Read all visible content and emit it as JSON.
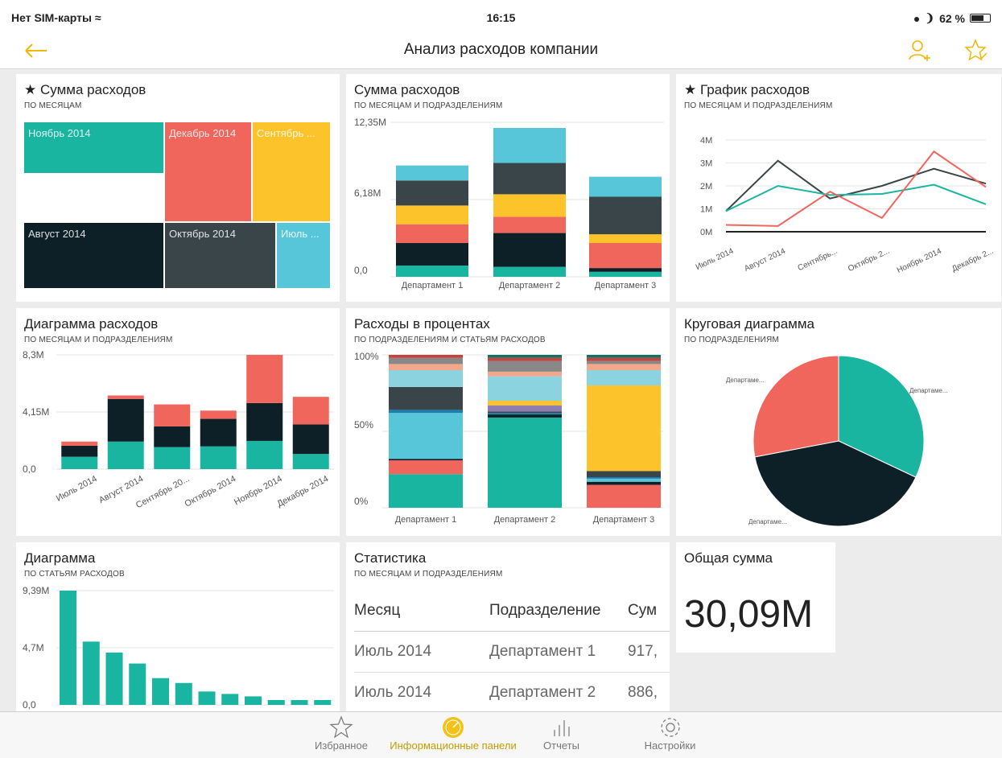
{
  "status_bar": {
    "carrier": "Нет SIM-карты",
    "time": "16:15",
    "battery": "62 %"
  },
  "nav": {
    "title": "Анализ расходов компании",
    "back_icon": "back-arrow-icon",
    "add_user_icon": "add-user-icon",
    "favorite_icon": "favorite-star-icon"
  },
  "tiles": {
    "treemap": {
      "title": "Сумма расходов",
      "subtitle": "ПО МЕСЯЦАМ",
      "starred": "★",
      "cells": [
        {
          "label": "Ноябрь 2014",
          "color": "#1ab5a0"
        },
        {
          "label": "Декабрь 2014",
          "color": "#f0665c"
        },
        {
          "label": "Сентябрь ...",
          "color": "#fcc42a"
        },
        {
          "label": "Август 2014",
          "color": "#0e2027"
        },
        {
          "label": "Октябрь 2014",
          "color": "#394548"
        },
        {
          "label": "Июль ...",
          "color": "#57c6d8"
        }
      ]
    },
    "stacked_bars": {
      "title": "Сумма расходов",
      "subtitle": "ПО МЕСЯЦАМ И ПОДРАЗДЕЛЕНИЯМ",
      "y_ticks": [
        "12,35M",
        "6,18M",
        "0,0"
      ]
    },
    "line_chart": {
      "title": "График расходов",
      "subtitle": "ПО МЕСЯЦАМ И ПОДРАЗДЕЛЕНИЯМ",
      "starred": "★",
      "y_ticks": [
        "4M",
        "3M",
        "2M",
        "1M",
        "0M"
      ]
    },
    "column_chart": {
      "title": "Диаграмма расходов",
      "subtitle": "ПО МЕСЯЦАМ И ПОДРАЗДЕЛЕНИЯМ",
      "y_ticks": [
        "8,3M",
        "4,15M",
        "0,0"
      ]
    },
    "percent_chart": {
      "title": "Расходы в процентах",
      "subtitle": "ПО ПОДРАЗДЕЛЕНИЯМ И СТАТЬЯМ РАСХОДОВ",
      "y_ticks": [
        "100%",
        "50%",
        "0%"
      ]
    },
    "pie_chart": {
      "title": "Круговая диаграмма",
      "subtitle": "ПО ПОДРАЗДЕЛЕНИЯМ"
    },
    "bar_chart": {
      "title": "Диаграмма",
      "subtitle": "ПО СТАТЬЯМ РАСХОДОВ",
      "y_ticks": [
        "9,39M",
        "4,7M",
        "0,0"
      ]
    },
    "stats": {
      "title": "Статистика",
      "subtitle": "ПО МЕСЯЦАМ И ПОДРАЗДЕЛЕНИЯМ",
      "headers": [
        "Месяц",
        "Подразделение",
        "Сум"
      ],
      "rows": [
        [
          "Июль 2014",
          "Департамент 1",
          "917,"
        ],
        [
          "Июль 2014",
          "Департамент 2",
          "886,"
        ]
      ]
    },
    "kpi": {
      "title": "Общая сумма",
      "value": "30,09M"
    }
  },
  "chart_data": [
    {
      "type": "bar",
      "stacked": true,
      "categories": [
        "Департамент 1",
        "Департамент 2",
        "Департамент 3"
      ],
      "ylim": [
        0,
        12.35
      ],
      "series": [
        {
          "color": "#1ab5a0",
          "values": [
            0.9,
            0.8,
            0.4
          ]
        },
        {
          "color": "#0e2027",
          "values": [
            1.8,
            2.7,
            0.3
          ]
        },
        {
          "color": "#f0665c",
          "values": [
            1.5,
            1.3,
            2.0
          ]
        },
        {
          "color": "#fcc42a",
          "values": [
            1.5,
            1.8,
            0.7
          ]
        },
        {
          "color": "#394548",
          "values": [
            2.0,
            2.5,
            3.0
          ]
        },
        {
          "color": "#57c6d8",
          "values": [
            1.2,
            2.8,
            1.6
          ]
        }
      ]
    },
    {
      "type": "line",
      "categories": [
        "Июль 2014",
        "Август 2014",
        "Сентябрь...",
        "Октябрь 2...",
        "Ноябрь 2014",
        "Декабрь 2..."
      ],
      "ylim": [
        0,
        4
      ],
      "series": [
        {
          "color": "#394548",
          "values": [
            0.9,
            3.1,
            1.45,
            2.0,
            2.75,
            2.1
          ]
        },
        {
          "color": "#1ab5a0",
          "values": [
            0.9,
            2.0,
            1.6,
            1.65,
            2.05,
            1.2
          ]
        },
        {
          "color": "#f0665c",
          "values": [
            0.3,
            0.25,
            1.75,
            0.6,
            3.5,
            1.95
          ]
        },
        {
          "color": "#222222",
          "values": [
            0,
            0,
            0,
            0,
            0,
            0
          ]
        }
      ]
    },
    {
      "type": "bar",
      "stacked": true,
      "categories": [
        "Июль 2014",
        "Август 2014",
        "Сентябрь 20...",
        "Октябрь 2014",
        "Ноябрь 2014",
        "Декабрь 2014"
      ],
      "ylim": [
        0,
        8.3
      ],
      "series": [
        {
          "color": "#1ab5a0",
          "values": [
            0.9,
            2.0,
            1.6,
            1.65,
            2.05,
            1.1
          ]
        },
        {
          "color": "#0e2027",
          "values": [
            0.8,
            3.1,
            1.5,
            2.0,
            2.75,
            2.15
          ]
        },
        {
          "color": "#f0665c",
          "values": [
            0.3,
            0.25,
            1.6,
            0.6,
            3.5,
            2.0
          ]
        }
      ]
    },
    {
      "type": "bar",
      "stacked": true,
      "percent": true,
      "categories": [
        "Департамент 1",
        "Департамент 2",
        "Департамент 3"
      ],
      "ylim": [
        0,
        100
      ],
      "series": [
        {
          "color": "#1ab5a0",
          "values": [
            22,
            59,
            0
          ]
        },
        {
          "color": "#f0665c",
          "values": [
            9,
            0,
            15
          ]
        },
        {
          "color": "#0e2027",
          "values": [
            1,
            2,
            2
          ]
        },
        {
          "color": "#57c6d8",
          "values": [
            30,
            0,
            2
          ]
        },
        {
          "color": "#1a7fb0",
          "values": [
            2,
            1,
            1
          ]
        },
        {
          "color": "#394548",
          "values": [
            15,
            1,
            4
          ]
        },
        {
          "color": "#8f7fb0",
          "values": [
            0,
            4,
            0
          ]
        },
        {
          "color": "#fcc42a",
          "values": [
            0,
            3,
            56
          ]
        },
        {
          "color": "#8cd3e0",
          "values": [
            11,
            16,
            10
          ]
        },
        {
          "color": "#f5a78c",
          "values": [
            4,
            3,
            4
          ]
        },
        {
          "color": "#888888",
          "values": [
            4,
            7,
            2
          ]
        },
        {
          "color": "#c8423d",
          "values": [
            2,
            2,
            2
          ]
        },
        {
          "color": "#1a6f5e",
          "values": [
            0,
            2,
            2
          ]
        }
      ]
    },
    {
      "type": "pie",
      "labels": [
        "Департаме...",
        "Департаме...",
        "Департаме..."
      ],
      "values": [
        32,
        40,
        28
      ],
      "colors": [
        "#1ab5a0",
        "#0e2027",
        "#f0665c"
      ]
    },
    {
      "type": "bar",
      "categories": [
        "",
        "",
        "",
        "",
        "",
        "",
        "",
        "",
        "",
        "",
        "",
        ""
      ],
      "ylim": [
        0,
        9.39
      ],
      "values": [
        9.39,
        5.2,
        4.3,
        3.4,
        2.2,
        1.8,
        1.1,
        0.9,
        0.7,
        0.4,
        0.4,
        0.4
      ],
      "color": "#1ab5a0"
    }
  ],
  "tabbar": {
    "items": [
      {
        "label": "Избранное",
        "icon": "star-icon"
      },
      {
        "label": "Информационные панели",
        "icon": "dashboard-icon"
      },
      {
        "label": "Отчеты",
        "icon": "reports-icon"
      },
      {
        "label": "Настройки",
        "icon": "settings-icon"
      }
    ]
  }
}
